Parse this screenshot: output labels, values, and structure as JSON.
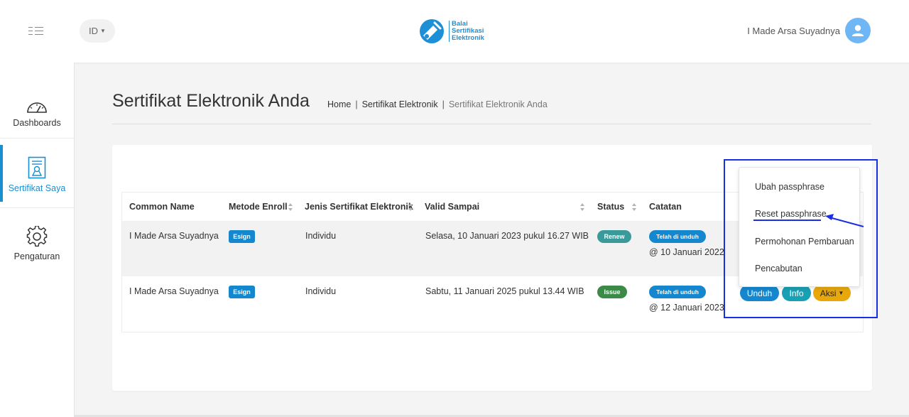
{
  "header": {
    "language": "ID",
    "logo_lines": [
      "Balai",
      "Sertifikasi",
      "Elektronik"
    ],
    "user_name": "I Made Arsa Suyadnya"
  },
  "sidebar": {
    "items": [
      {
        "label": "Dashboards",
        "icon": "gauge-icon",
        "active": false
      },
      {
        "label": "Sertifikat Saya",
        "icon": "certificate-icon",
        "active": true
      },
      {
        "label": "Pengaturan",
        "icon": "gear-icon",
        "active": false
      }
    ]
  },
  "page": {
    "title": "Sertifikat Elektronik Anda",
    "breadcrumb": [
      "Home",
      "Sertifikat Elektronik",
      "Sertifikat Elektronik Anda"
    ],
    "breadcrumb_sep": "|"
  },
  "table": {
    "columns": [
      "Common Name",
      "Metode Enroll",
      "Jenis Sertifikat Elektronik",
      "Valid Sampai",
      "Status",
      "Catatan"
    ],
    "rows": [
      {
        "common_name": "I Made Arsa Suyadnya",
        "method": "Esign",
        "type": "Individu",
        "valid_until": "Selasa, 10 Januari 2023 pukul 16.27 WIB",
        "status": "Renew",
        "note_badge": "Telah di unduh",
        "note_date": "@ 10 Januari 2022"
      },
      {
        "common_name": "I Made Arsa Suyadnya",
        "method": "Esign",
        "type": "Individu",
        "valid_until": "Sabtu, 11 Januari 2025 pukul 13.44 WIB",
        "status": "Issue",
        "note_badge": "Telah di unduh",
        "note_date": "@ 12 Januari 2023"
      }
    ],
    "actions": {
      "download": "Unduh",
      "info": "Info",
      "action": "Aksi"
    }
  },
  "action_menu": {
    "items": [
      "Ubah passphrase",
      "Reset passphrase",
      "Permohonan Pembaruan",
      "Pencabutan"
    ]
  },
  "colors": {
    "primary": "#1487cf",
    "renew": "#3a9a9a",
    "issue": "#3b8a47",
    "info": "#18a0b4",
    "aksi": "#e8a80c",
    "annotation": "#1a2ee6"
  }
}
